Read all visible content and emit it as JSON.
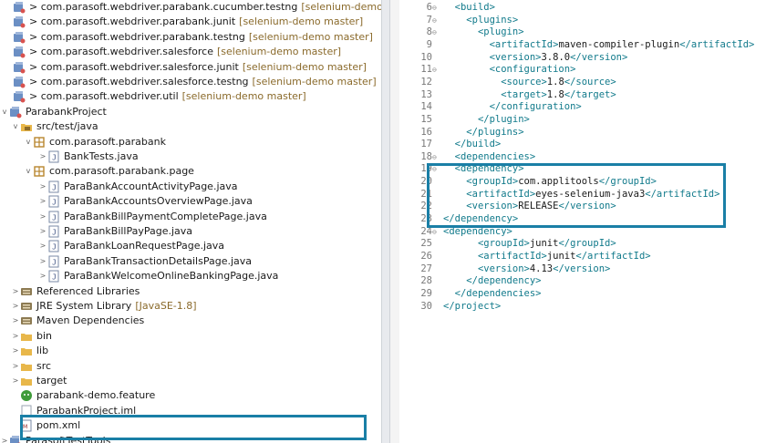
{
  "colors": {
    "highlight": "#1a7fa6",
    "tag": "#117a8b",
    "folder": "#e8b74a",
    "jar": "#8c7a52",
    "package": "#b8862e"
  },
  "explorer": {
    "items": [
      {
        "expander": "",
        "icon": "project",
        "label": "> com.parasoft.webdriver.parabank.cucumber.testng",
        "deco": "[selenium-demo master]"
      },
      {
        "expander": "",
        "icon": "project",
        "label": "> com.parasoft.webdriver.parabank.junit",
        "deco": "[selenium-demo master]"
      },
      {
        "expander": "",
        "icon": "project",
        "label": "> com.parasoft.webdriver.parabank.testng",
        "deco": "[selenium-demo master]"
      },
      {
        "expander": "",
        "icon": "project",
        "label": "> com.parasoft.webdriver.salesforce",
        "deco": "[selenium-demo master]"
      },
      {
        "expander": "",
        "icon": "project",
        "label": "> com.parasoft.webdriver.salesforce.junit",
        "deco": "[selenium-demo master]"
      },
      {
        "expander": "",
        "icon": "project",
        "label": "> com.parasoft.webdriver.salesforce.testng",
        "deco": "[selenium-demo master]"
      },
      {
        "expander": "",
        "icon": "project",
        "label": "> com.parasoft.webdriver.util",
        "deco": "[selenium-demo master]"
      },
      {
        "expander": "v",
        "icon": "project",
        "label": "ParabankProject",
        "deco": ""
      },
      {
        "expander": "v",
        "icon": "srcfolder",
        "label": "src/test/java",
        "deco": ""
      },
      {
        "expander": "v",
        "icon": "package",
        "label": "com.parasoft.parabank",
        "deco": ""
      },
      {
        "expander": ">",
        "icon": "java",
        "label": "BankTests.java",
        "deco": ""
      },
      {
        "expander": "v",
        "icon": "package",
        "label": "com.parasoft.parabank.page",
        "deco": ""
      },
      {
        "expander": ">",
        "icon": "java",
        "label": "ParaBankAccountActivityPage.java",
        "deco": ""
      },
      {
        "expander": ">",
        "icon": "java",
        "label": "ParaBankAccountsOverviewPage.java",
        "deco": ""
      },
      {
        "expander": ">",
        "icon": "java",
        "label": "ParaBankBillPaymentCompletePage.java",
        "deco": ""
      },
      {
        "expander": ">",
        "icon": "java",
        "label": "ParaBankBillPayPage.java",
        "deco": ""
      },
      {
        "expander": ">",
        "icon": "java",
        "label": "ParaBankLoanRequestPage.java",
        "deco": ""
      },
      {
        "expander": ">",
        "icon": "java",
        "label": "ParaBankTransactionDetailsPage.java",
        "deco": ""
      },
      {
        "expander": ">",
        "icon": "java",
        "label": "ParaBankWelcomeOnlineBankingPage.java",
        "deco": ""
      },
      {
        "expander": ">",
        "icon": "library",
        "label": "Referenced Libraries",
        "deco": ""
      },
      {
        "expander": ">",
        "icon": "library",
        "label": "JRE System Library",
        "deco": "[JavaSE-1.8]"
      },
      {
        "expander": ">",
        "icon": "library",
        "label": "Maven Dependencies",
        "deco": ""
      },
      {
        "expander": ">",
        "icon": "folder",
        "label": "bin",
        "deco": ""
      },
      {
        "expander": ">",
        "icon": "folder",
        "label": "lib",
        "deco": ""
      },
      {
        "expander": ">",
        "icon": "folder",
        "label": "src",
        "deco": ""
      },
      {
        "expander": ">",
        "icon": "folder",
        "label": "target",
        "deco": ""
      },
      {
        "expander": "",
        "icon": "feature",
        "label": "parabank-demo.feature",
        "deco": ""
      },
      {
        "expander": "",
        "icon": "file",
        "label": "ParabankProject.iml",
        "deco": ""
      },
      {
        "expander": "",
        "icon": "xml",
        "label": "pom.xml",
        "deco": ""
      },
      {
        "expander": ">",
        "icon": "project",
        "label": "ParasoftTestTools",
        "deco": ""
      }
    ]
  },
  "editor": {
    "lines": [
      {
        "n": "6",
        "fold": "⊖",
        "indent": "  ",
        "parts": [
          [
            "t",
            "<build>"
          ]
        ]
      },
      {
        "n": "7",
        "fold": "⊖",
        "indent": "    ",
        "parts": [
          [
            "t",
            "<plugins>"
          ]
        ]
      },
      {
        "n": "8",
        "fold": "⊖",
        "indent": "      ",
        "parts": [
          [
            "t",
            "<plugin>"
          ]
        ]
      },
      {
        "n": "9",
        "fold": "",
        "indent": "        ",
        "parts": [
          [
            "t",
            "<artifactId>"
          ],
          [
            "x",
            "maven-compiler-plugin"
          ],
          [
            "t",
            "</artifactId>"
          ]
        ]
      },
      {
        "n": "10",
        "fold": "",
        "indent": "        ",
        "parts": [
          [
            "t",
            "<version>"
          ],
          [
            "x",
            "3.8.0"
          ],
          [
            "t",
            "</version>"
          ]
        ]
      },
      {
        "n": "11",
        "fold": "⊖",
        "indent": "        ",
        "parts": [
          [
            "t",
            "<configuration>"
          ]
        ]
      },
      {
        "n": "12",
        "fold": "",
        "indent": "          ",
        "parts": [
          [
            "t",
            "<source>"
          ],
          [
            "x",
            "1.8"
          ],
          [
            "t",
            "</source>"
          ]
        ]
      },
      {
        "n": "13",
        "fold": "",
        "indent": "          ",
        "parts": [
          [
            "t",
            "<target>"
          ],
          [
            "x",
            "1.8"
          ],
          [
            "t",
            "</target>"
          ]
        ]
      },
      {
        "n": "14",
        "fold": "",
        "indent": "        ",
        "parts": [
          [
            "t",
            "</configuration>"
          ]
        ]
      },
      {
        "n": "15",
        "fold": "",
        "indent": "      ",
        "parts": [
          [
            "t",
            "</plugin>"
          ]
        ]
      },
      {
        "n": "16",
        "fold": "",
        "indent": "    ",
        "parts": [
          [
            "t",
            "</plugins>"
          ]
        ]
      },
      {
        "n": "17",
        "fold": "",
        "indent": "  ",
        "parts": [
          [
            "t",
            "</build>"
          ]
        ]
      },
      {
        "n": "18",
        "fold": "⊖",
        "indent": "  ",
        "parts": [
          [
            "t",
            "<dependencies>"
          ]
        ]
      },
      {
        "n": "19",
        "fold": "⊖",
        "indent": "  ",
        "parts": [
          [
            "t",
            "<dependency>"
          ]
        ]
      },
      {
        "n": "20",
        "fold": "",
        "indent": "    ",
        "parts": [
          [
            "t",
            "<groupId>"
          ],
          [
            "x",
            "com.applitools"
          ],
          [
            "t",
            "</groupId>"
          ]
        ]
      },
      {
        "n": "21",
        "fold": "",
        "indent": "    ",
        "parts": [
          [
            "t",
            "<artifactId>"
          ],
          [
            "x",
            "eyes-selenium-java3"
          ],
          [
            "t",
            "</artifactId>"
          ]
        ]
      },
      {
        "n": "22",
        "fold": "",
        "indent": "    ",
        "parts": [
          [
            "t",
            "<version>"
          ],
          [
            "x",
            "RELEASE"
          ],
          [
            "t",
            "</version>"
          ]
        ]
      },
      {
        "n": "23",
        "fold": "",
        "indent": "",
        "parts": [
          [
            "t",
            "</dependency>"
          ]
        ]
      },
      {
        "n": "24",
        "fold": "⊖",
        "indent": "",
        "parts": [
          [
            "t",
            "<dependency>"
          ]
        ]
      },
      {
        "n": "25",
        "fold": "",
        "indent": "      ",
        "parts": [
          [
            "t",
            "<groupId>"
          ],
          [
            "x",
            "junit"
          ],
          [
            "t",
            "</groupId>"
          ]
        ]
      },
      {
        "n": "26",
        "fold": "",
        "indent": "      ",
        "parts": [
          [
            "t",
            "<artifactId>"
          ],
          [
            "x",
            "junit"
          ],
          [
            "t",
            "</artifactId>"
          ]
        ]
      },
      {
        "n": "27",
        "fold": "",
        "indent": "      ",
        "parts": [
          [
            "t",
            "<version>"
          ],
          [
            "x",
            "4.13"
          ],
          [
            "t",
            "</version>"
          ]
        ]
      },
      {
        "n": "28",
        "fold": "",
        "indent": "    ",
        "parts": [
          [
            "t",
            "</dependency>"
          ]
        ]
      },
      {
        "n": "29",
        "fold": "",
        "indent": "  ",
        "parts": [
          [
            "t",
            "</dependencies>"
          ]
        ]
      },
      {
        "n": "30",
        "fold": "",
        "indent": "",
        "parts": [
          [
            "t",
            "</project>"
          ]
        ]
      }
    ]
  }
}
